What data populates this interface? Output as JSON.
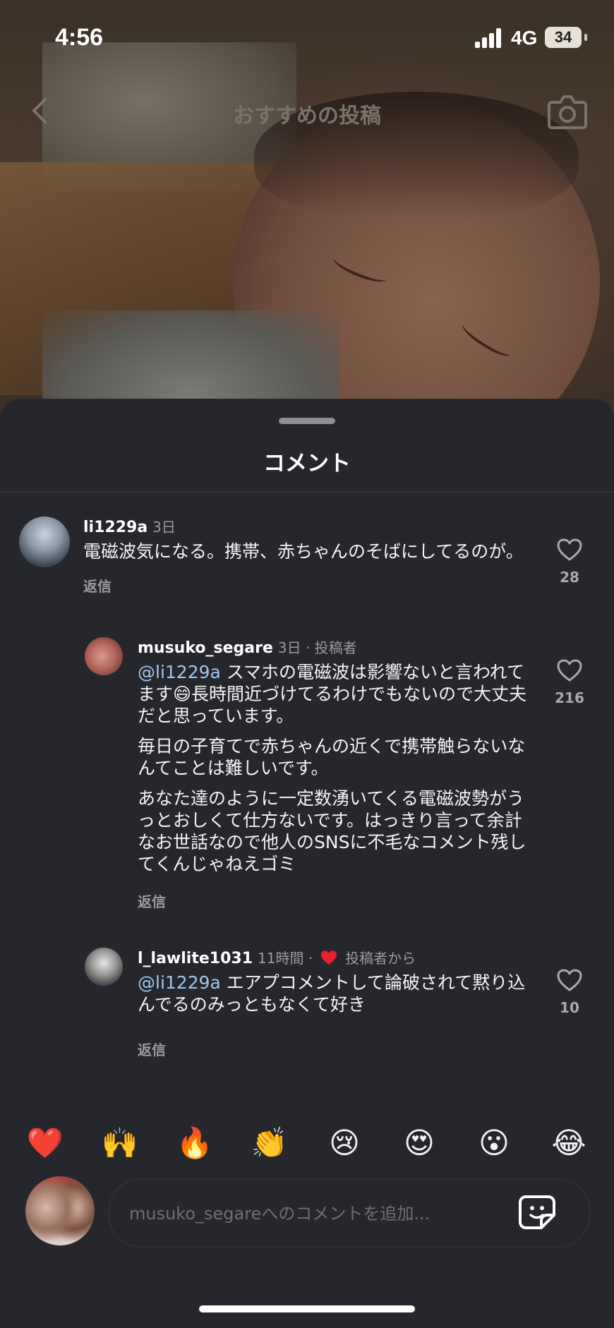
{
  "status_bar": {
    "time": "4:56",
    "network": "4G",
    "battery": "34"
  },
  "nav": {
    "title": "おすすめの投稿"
  },
  "sheet": {
    "title": "コメント"
  },
  "comments": [
    {
      "username": "li1229a",
      "meta": "3日",
      "text": "電磁波気になる。携帯、赤ちゃんのそばにしてるのが。",
      "reply": "返信",
      "likes": "28"
    },
    {
      "username": "musuko_segare",
      "meta": "3日 · 投稿者",
      "mention": "@li1229a",
      "text1": " スマホの電磁波は影響ないと言われてます😄長時間近づけてるわけでもないので大丈夫だと思っています。",
      "text2": "毎日の子育てで赤ちゃんの近くで携帯触らないなんてことは難しいです。",
      "text3": "あなた達のように一定数湧いてくる電磁波勢がうっとおしくて仕方ないです。はっきり言って余計なお世話なので他人のSNSに不毛なコメント残してくんじゃねえゴミ",
      "reply": "返信",
      "likes": "216"
    },
    {
      "username": "l_lawlite1031",
      "meta_time": "11時間 ·",
      "meta_from": "投稿者から",
      "mention": "@li1229a",
      "text": " エアプコメントして論破されて黙り込んでるのみっともなくて好き",
      "reply": "返信",
      "likes": "10"
    }
  ],
  "reactions": [
    "❤️",
    "🙌",
    "🔥",
    "👏",
    "😢",
    "😍",
    "😮",
    "😂"
  ],
  "input": {
    "placeholder": "musuko_segareへのコメントを追加..."
  },
  "colors": {
    "background": "#25272d",
    "mention": "#9fc6ee",
    "heart": "#e8202a"
  },
  "icons": [
    "back-icon",
    "camera-icon",
    "heart-outline-icon",
    "heart-filled-icon",
    "sticker-icon"
  ]
}
